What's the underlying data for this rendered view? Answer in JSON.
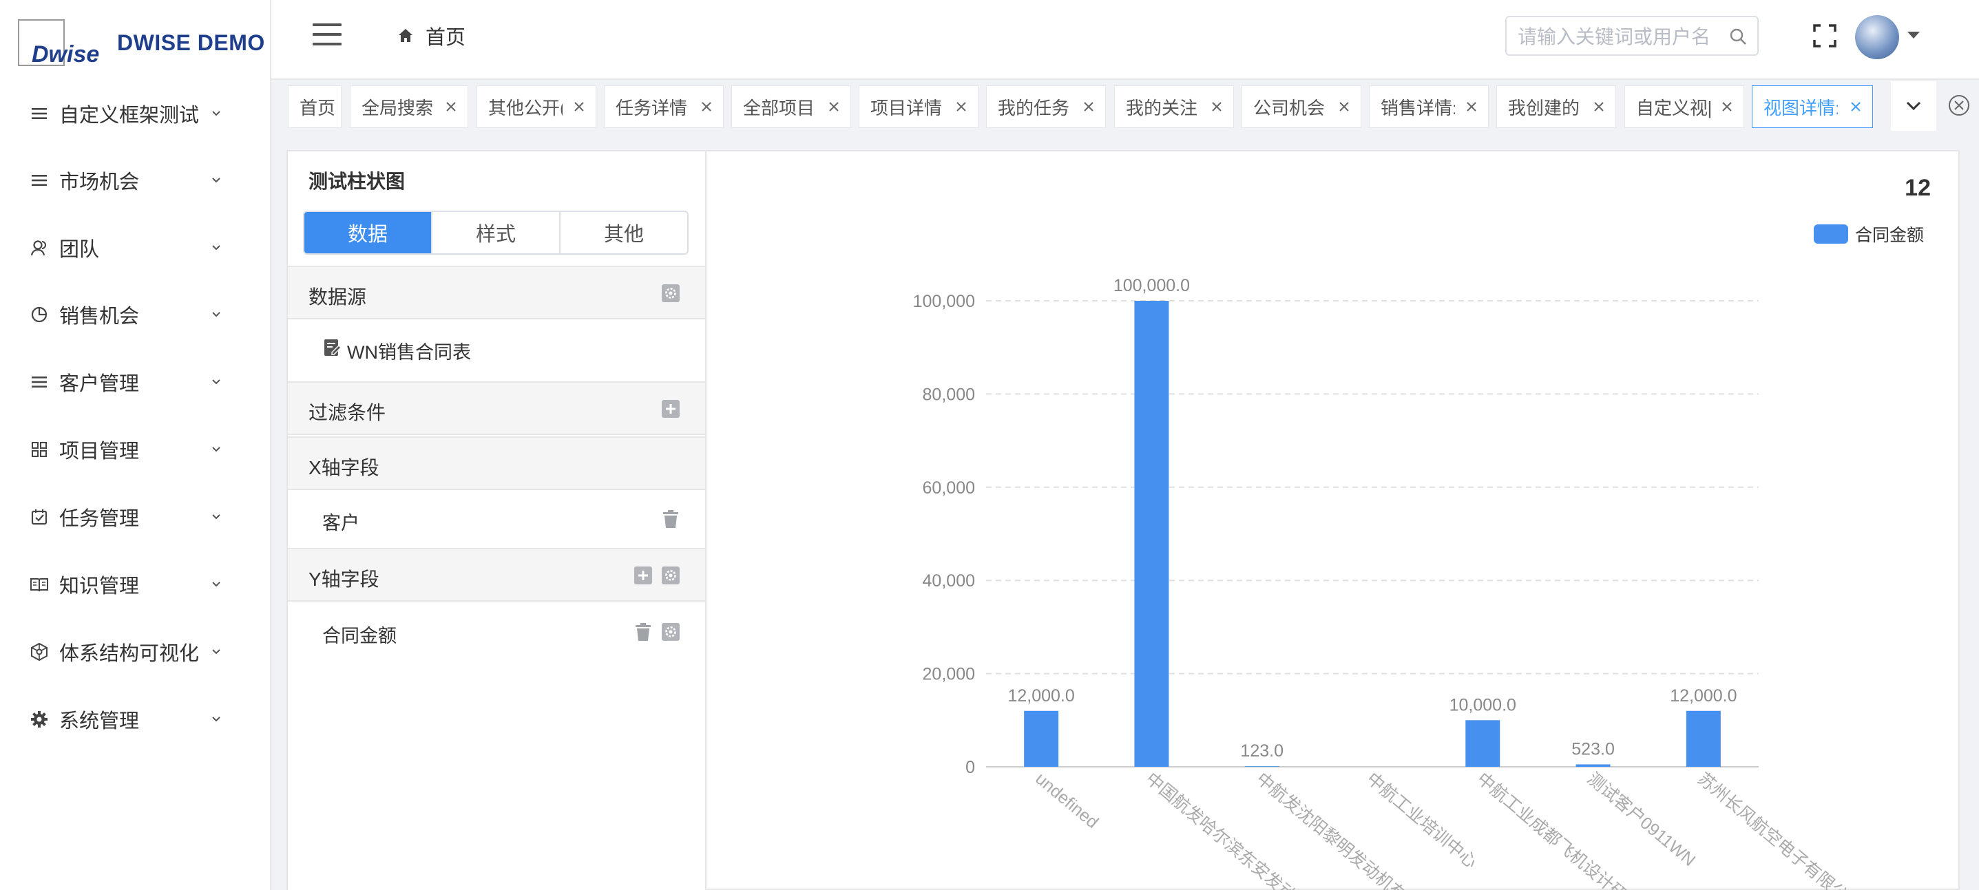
{
  "app": {
    "logo_mark": "Dwise",
    "name": "DWISE DEMO"
  },
  "sidebar": {
    "items": [
      {
        "label": "自定义框架测试",
        "icon": "list-icon"
      },
      {
        "label": "市场机会",
        "icon": "list-icon"
      },
      {
        "label": "团队",
        "icon": "team-icon"
      },
      {
        "label": "销售机会",
        "icon": "pie-icon"
      },
      {
        "label": "客户管理",
        "icon": "list-icon"
      },
      {
        "label": "项目管理",
        "icon": "grid-icon"
      },
      {
        "label": "任务管理",
        "icon": "checkbox-icon"
      },
      {
        "label": "知识管理",
        "icon": "book-icon"
      },
      {
        "label": "体系结构可视化",
        "icon": "hexagon-icon"
      },
      {
        "label": "系统管理",
        "icon": "gear-icon"
      }
    ]
  },
  "header": {
    "breadcrumb": "首页",
    "search_placeholder": "请输入关键词或用户名"
  },
  "tabs": [
    {
      "label": "首页",
      "closable": false
    },
    {
      "label": "全局搜索",
      "closable": true
    },
    {
      "label": "其他公开(",
      "closable": true
    },
    {
      "label": "任务详情",
      "closable": true
    },
    {
      "label": "全部项目",
      "closable": true
    },
    {
      "label": "项目详情",
      "closable": true
    },
    {
      "label": "我的任务",
      "closable": true
    },
    {
      "label": "我的关注",
      "closable": true
    },
    {
      "label": "公司机会",
      "closable": true
    },
    {
      "label": "销售详情:",
      "closable": true
    },
    {
      "label": "我创建的",
      "closable": true
    },
    {
      "label": "自定义视[",
      "closable": true
    },
    {
      "label": "视图详情:",
      "closable": true,
      "active": true
    }
  ],
  "config": {
    "title": "测试柱状图",
    "segments": [
      {
        "label": "数据",
        "active": true
      },
      {
        "label": "样式"
      },
      {
        "label": "其他"
      }
    ],
    "datasource_title": "数据源",
    "datasource_value": "WN销售合同表",
    "filter_title": "过滤条件",
    "x_title": "X轴字段",
    "x_value": "客户",
    "y_title": "Y轴字段",
    "y_value": "合同金额"
  },
  "chart_header": {
    "count": "12",
    "legend": "合同金额"
  },
  "chart_data": {
    "type": "bar",
    "categories": [
      "undefined",
      "中国航发哈尔滨东安发动",
      "中航发沈阳黎明发动机有",
      "中航工业培训中心",
      "中航工业成都飞机设计研",
      "测试客户0911WN",
      "苏州长风航空电子有限公"
    ],
    "series": [
      {
        "name": "合同金额",
        "values": [
          12000,
          100000,
          123,
          0,
          10000,
          523,
          12000
        ]
      }
    ],
    "data_labels": [
      "12,000.0",
      "100,000.0",
      "123.0",
      "",
      "10,000.0",
      "523.0",
      "12,000.0"
    ],
    "yticks": [
      "0",
      "20,000",
      "40,000",
      "60,000",
      "80,000",
      "100,000"
    ],
    "ylim": [
      0,
      100000
    ],
    "color": "#4690f0",
    "grid": true,
    "legend_position": "top-right"
  }
}
